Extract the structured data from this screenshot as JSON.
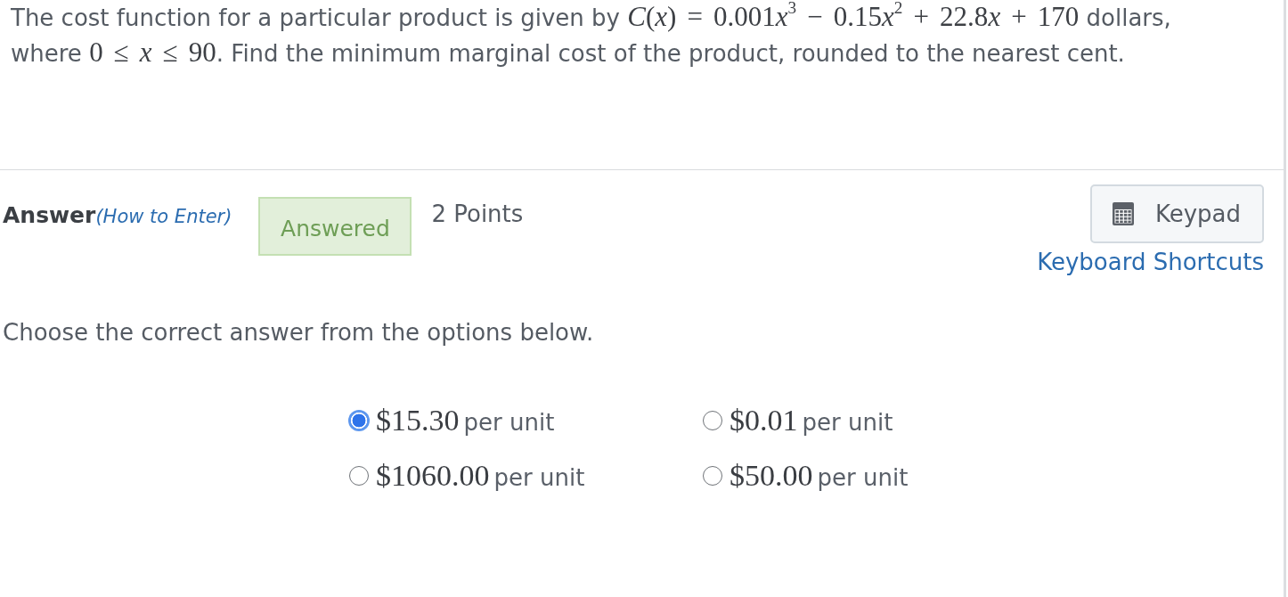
{
  "question": {
    "segments": [
      {
        "kind": "text",
        "text": "The cost function for a particular product is given by "
      },
      {
        "kind": "var",
        "text": "C"
      },
      {
        "kind": "math",
        "text": "("
      },
      {
        "kind": "var",
        "text": "x"
      },
      {
        "kind": "math",
        "text": ") = 0.001"
      },
      {
        "kind": "var",
        "text": "x$^{3}$"
      },
      {
        "kind": "math",
        "text": " − 0.15"
      },
      {
        "kind": "var",
        "text": "x$^{2}$"
      },
      {
        "kind": "math",
        "text": " + 22.8"
      },
      {
        "kind": "var",
        "text": "x"
      },
      {
        "kind": "math",
        "text": " + 170"
      },
      {
        "kind": "text",
        "text": " dollars, where "
      },
      {
        "kind": "math",
        "text": "0 ≤ "
      },
      {
        "kind": "var",
        "text": "x"
      },
      {
        "kind": "math",
        "text": " ≤ 90"
      },
      {
        "kind": "text",
        "text": ". Find the minimum marginal cost of the product, rounded to the nearest cent."
      }
    ]
  },
  "answer_bar": {
    "label": "Answer",
    "help_link": "(How to Enter)",
    "status": "Answered",
    "points": "2 Points",
    "keypad_button": "Keypad",
    "shortcuts_link": "Keyboard Shortcuts"
  },
  "instruction": "Choose the correct answer from the options below.",
  "options": [
    {
      "amount": "$15.30",
      "unit": "per unit",
      "selected": true
    },
    {
      "amount": "$0.01",
      "unit": "per unit",
      "selected": false
    },
    {
      "amount": "$1060.00",
      "unit": "per unit",
      "selected": false
    },
    {
      "amount": "$50.00",
      "unit": "per unit",
      "selected": false
    }
  ]
}
